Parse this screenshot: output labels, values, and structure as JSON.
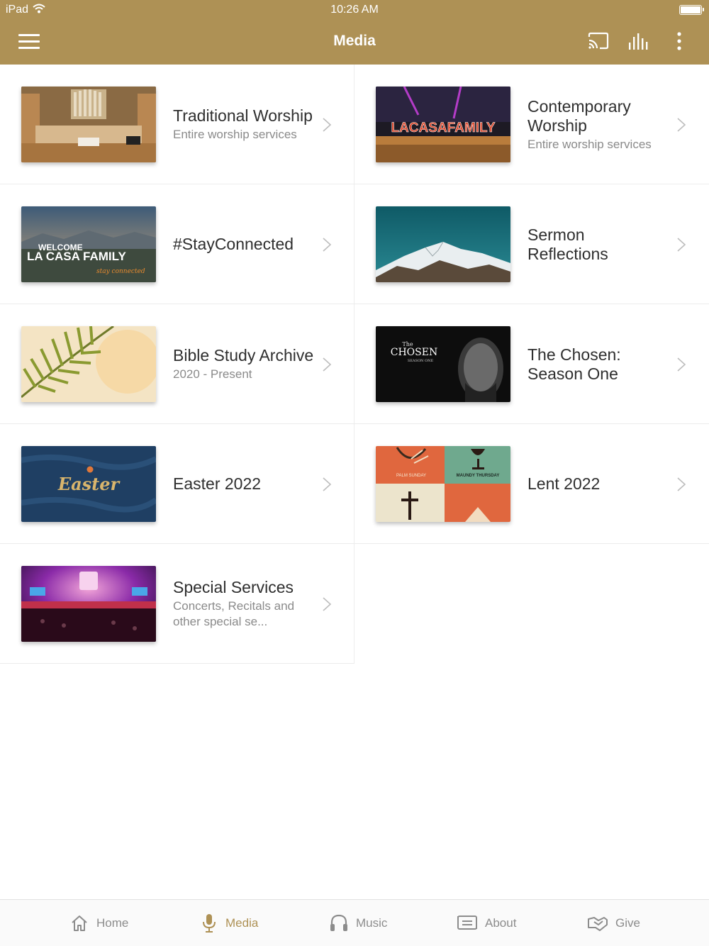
{
  "status_bar": {
    "carrier": "iPad",
    "time": "10:26 AM"
  },
  "header": {
    "title": "Media",
    "accent_color": "#ae9155"
  },
  "icons": {
    "menu": "hamburger-icon",
    "cast": "cast-icon",
    "audio": "audio-bars-icon",
    "more": "more-vertical-icon"
  },
  "items": [
    {
      "title": "Traditional Worship",
      "subtitle": "Entire worship services",
      "thumb": "organ-sanctuary"
    },
    {
      "title": "Contemporary Worship",
      "subtitle": "Entire worship services",
      "thumb": "stage-la-casa-family",
      "thumb_text": "LACASAFAMILY"
    },
    {
      "title": "#StayConnected",
      "subtitle": "",
      "thumb": "welcome-banner",
      "thumb_text_1": "WELCOME",
      "thumb_text_2": "LA CASA FAMILY",
      "thumb_text_3": "stay connected"
    },
    {
      "title": "Sermon Reflections",
      "subtitle": "",
      "thumb": "mountain-sky"
    },
    {
      "title": "Bible Study Archive",
      "subtitle": "2020 - Present",
      "thumb": "palm-leaf"
    },
    {
      "title": "The Chosen: Season One",
      "subtitle": "",
      "thumb": "the-chosen-poster",
      "thumb_text_1": "The",
      "thumb_text_2": "CHOSEN",
      "thumb_text_3": "SEASON ONE"
    },
    {
      "title": "Easter 2022",
      "subtitle": "",
      "thumb": "easter-banner",
      "thumb_text": "Easter"
    },
    {
      "title": "Lent 2022",
      "subtitle": "",
      "thumb": "lent-quad",
      "thumb_text_1": "PALM SUNDAY",
      "thumb_text_2": "MAUNDY THURSDAY"
    },
    {
      "title": "Special Services",
      "subtitle": "Concerts, Recitals and other special se...",
      "thumb": "concert-hall"
    }
  ],
  "tabs": [
    {
      "label": "Home",
      "icon": "home-icon",
      "active": false
    },
    {
      "label": "Media",
      "icon": "microphone-icon",
      "active": true
    },
    {
      "label": "Music",
      "icon": "headphones-icon",
      "active": false
    },
    {
      "label": "About",
      "icon": "message-icon",
      "active": false
    },
    {
      "label": "Give",
      "icon": "give-hand-icon",
      "active": false
    }
  ]
}
